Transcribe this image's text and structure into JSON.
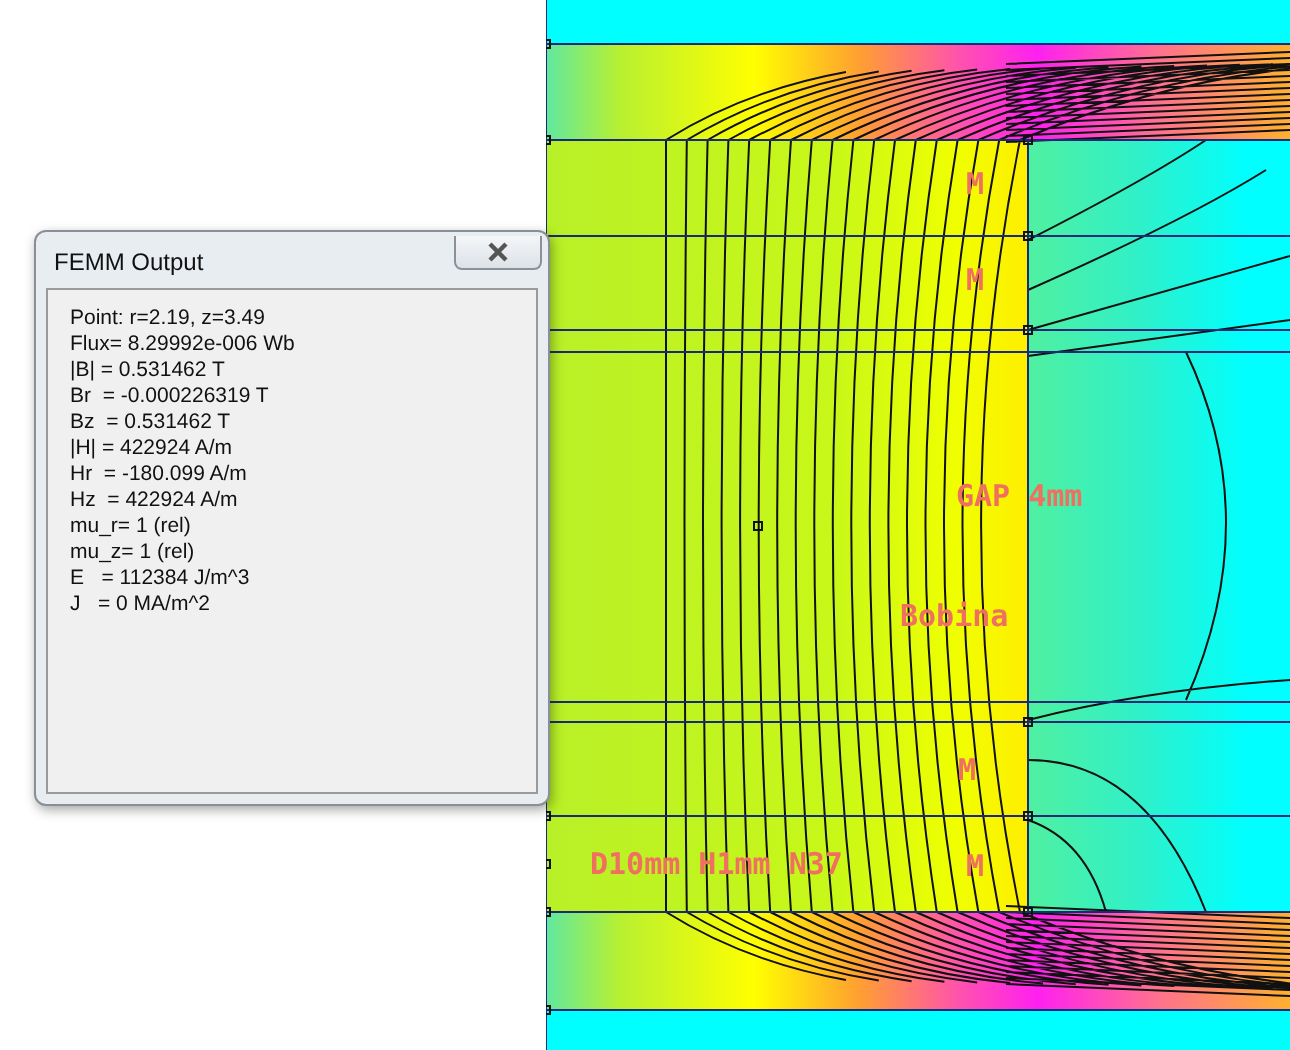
{
  "plot": {
    "labels": [
      "M",
      "M",
      "GAP 4mm",
      "Bobina",
      "M",
      "D10mm H1mm N37",
      "M"
    ]
  },
  "dialog": {
    "title": "FEMM Output",
    "lines": [
      "Point: r=2.19, z=3.49",
      "Flux= 8.29992e-006 Wb",
      "|B| = 0.531462 T",
      "Br  = -0.000226319 T",
      "Bz  = 0.531462 T",
      "|H| = 422924 A/m",
      "Hr  = -180.099 A/m",
      "Hz  = 422924 A/m",
      "mu_r= 1 (rel)",
      "mu_z= 1 (rel)",
      "E   = 112384 J/m^3",
      "J   = 0 MA/m^2"
    ]
  }
}
